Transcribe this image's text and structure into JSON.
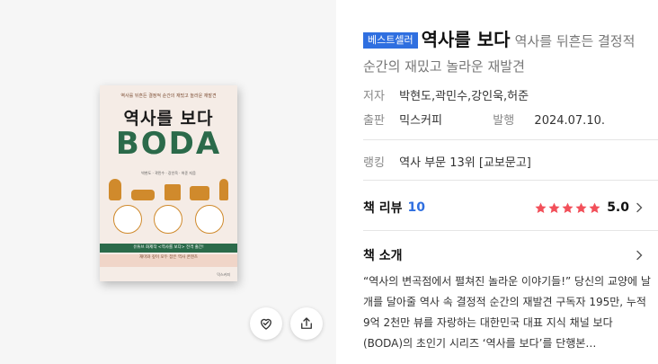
{
  "cover": {
    "blurb_top": "역사를 뒤흔든 결정적 순간의 재밌고 놀라운 재발견",
    "title": "역사를 보다",
    "title_en": "BODA",
    "authors": "박현도 · 곽민수 · 강인욱 · 허준 지음",
    "band_main": "유튜브 화제작 <역사를 보다> 전격 출간!",
    "band_sub": "재미와 깊이 모두 잡은 역사 콘텐츠",
    "publisher": "믹스커피"
  },
  "actions": {
    "wishlist_icon": "heart-check-icon",
    "share_icon": "share-icon"
  },
  "book": {
    "badge": "베스트셀러",
    "title": "역사를 보다",
    "subtitle": "역사를 뒤흔든 결정적 순간의 재밌고 놀라운 재발견",
    "author_label": "저자",
    "authors": "박현도,곽민수,강인욱,허준",
    "publisher_label": "출판",
    "publisher": "믹스커피",
    "date_label": "발행",
    "date": "2024.07.10.",
    "ranking_label": "랭킹",
    "ranking": "역사 부문 13위 [교보문고]"
  },
  "review": {
    "label": "책 리뷰",
    "count": "10",
    "score": "5.0",
    "stars": 5,
    "star_color": "#f2505a"
  },
  "intro": {
    "label": "책 소개",
    "text": "“역사의 변곡점에서 펼쳐진 놀라운 이야기들!” 당신의 교양에 날개를 달아줄 역사 속 결정적 순간의 재발견 구독자 195만, 누적 9억 2천만 뷰를 자랑하는 대한민국 대표 지식 채널 보다(BODA)의 초인기 시리즈 ‘역사를 보다’를 단행본…"
  },
  "colors": {
    "accent": "#2f6fe0",
    "badge": "#2f6fe0",
    "cover_green": "#2b6a4a"
  }
}
